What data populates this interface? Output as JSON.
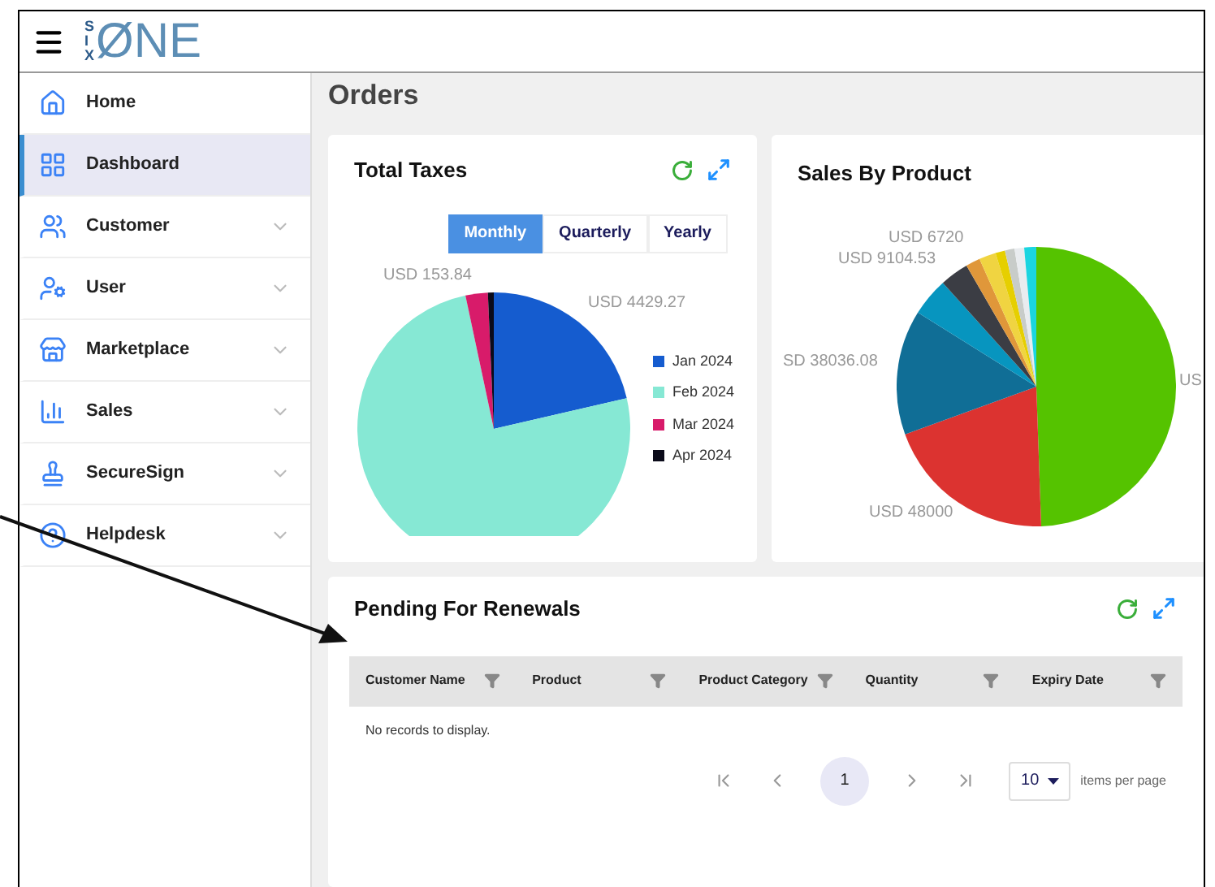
{
  "header": {
    "logo_small": "SIX",
    "logo_main": "ØNE"
  },
  "sidebar": {
    "items": [
      {
        "label": "Home",
        "selected": false,
        "expandable": false
      },
      {
        "label": "Dashboard",
        "selected": true,
        "expandable": false
      },
      {
        "label": "Customer",
        "selected": false,
        "expandable": true
      },
      {
        "label": "User",
        "selected": false,
        "expandable": true
      },
      {
        "label": "Marketplace",
        "selected": false,
        "expandable": true
      },
      {
        "label": "Sales",
        "selected": false,
        "expandable": true
      },
      {
        "label": "SecureSign",
        "selected": false,
        "expandable": true
      },
      {
        "label": "Helpdesk",
        "selected": false,
        "expandable": true
      }
    ]
  },
  "page_title": "Orders",
  "total_taxes": {
    "title": "Total Taxes",
    "periods": [
      {
        "label": "Monthly",
        "selected": true
      },
      {
        "label": "Quarterly",
        "selected": false
      },
      {
        "label": "Yearly",
        "selected": false
      }
    ],
    "slice_labels": [
      "USD 153.84",
      "USD 4429.27"
    ],
    "legend": [
      {
        "label": "Jan 2024",
        "color": "#155ccf"
      },
      {
        "label": "Feb 2024",
        "color": "#86e8d4"
      },
      {
        "label": "Mar 2024",
        "color": "#d81b6a"
      },
      {
        "label": "Apr 2024",
        "color": "#0b0b1a"
      }
    ]
  },
  "sales_by_product": {
    "title": "Sales By Product",
    "slice_labels": [
      "USD 6720",
      "USD 9104.53",
      "SD 38036.08",
      "USD 48000",
      "US"
    ]
  },
  "renewals": {
    "title": "Pending For Renewals",
    "columns": [
      "Customer Name",
      "Product",
      "Product Category",
      "Quantity",
      "Expiry Date"
    ],
    "empty_message": "No records to display.",
    "page": "1",
    "page_size": "10",
    "page_size_label": "items per page"
  }
}
